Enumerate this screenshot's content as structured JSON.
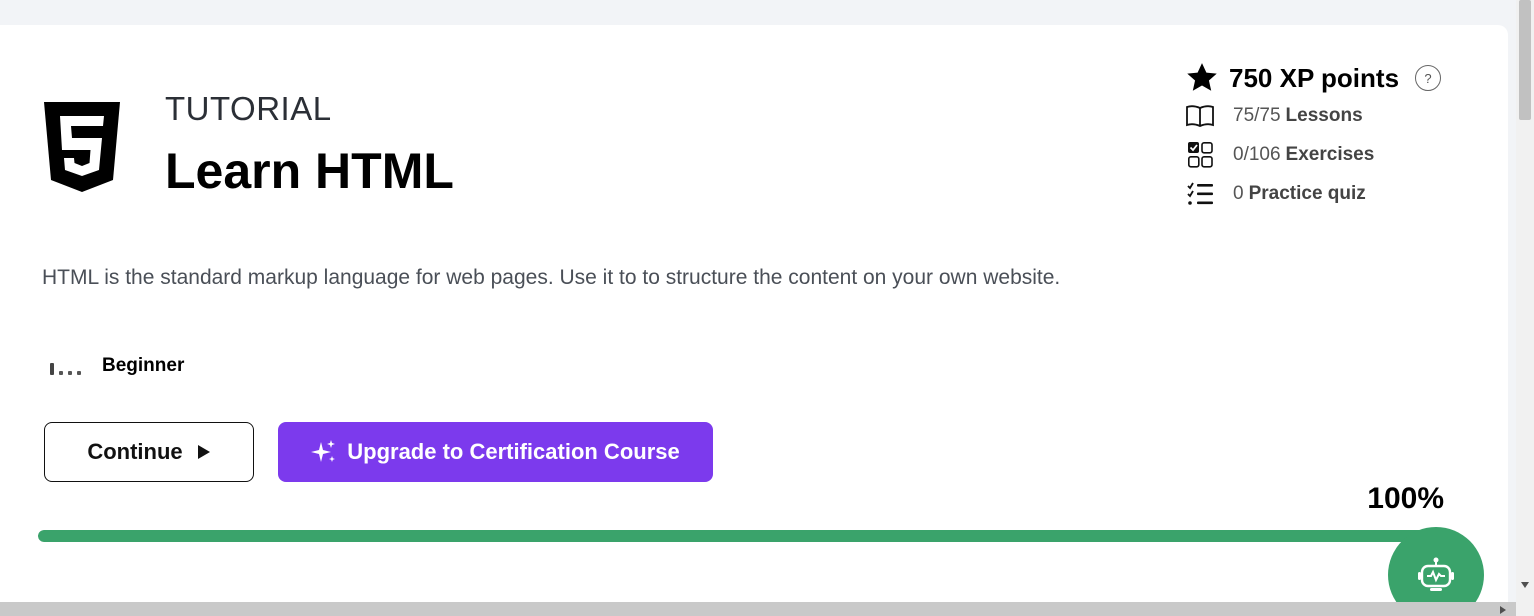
{
  "course": {
    "kicker": "TUTORIAL",
    "title": "Learn HTML",
    "logo_icon": "html5-logo-icon",
    "description": "HTML is the standard markup language for web pages. Use it to to structure the content on your own website.",
    "level": "Beginner"
  },
  "actions": {
    "continue_label": "Continue",
    "upgrade_label": "Upgrade to Certification Course",
    "upgrade_color": "#7c3aed"
  },
  "progress": {
    "percent_label": "100%",
    "value": 1.0,
    "color": "#3aa36b"
  },
  "stats": {
    "xp_label": "750 XP points",
    "help_label": "?",
    "lessons": {
      "value": "75/75",
      "name": "Lessons"
    },
    "exercises": {
      "value": "0/106",
      "name": "Exercises"
    },
    "quiz": {
      "value": "0",
      "name": "Practice quiz"
    }
  },
  "assistant": {
    "icon": "robot-icon",
    "color": "#3aa36b"
  }
}
